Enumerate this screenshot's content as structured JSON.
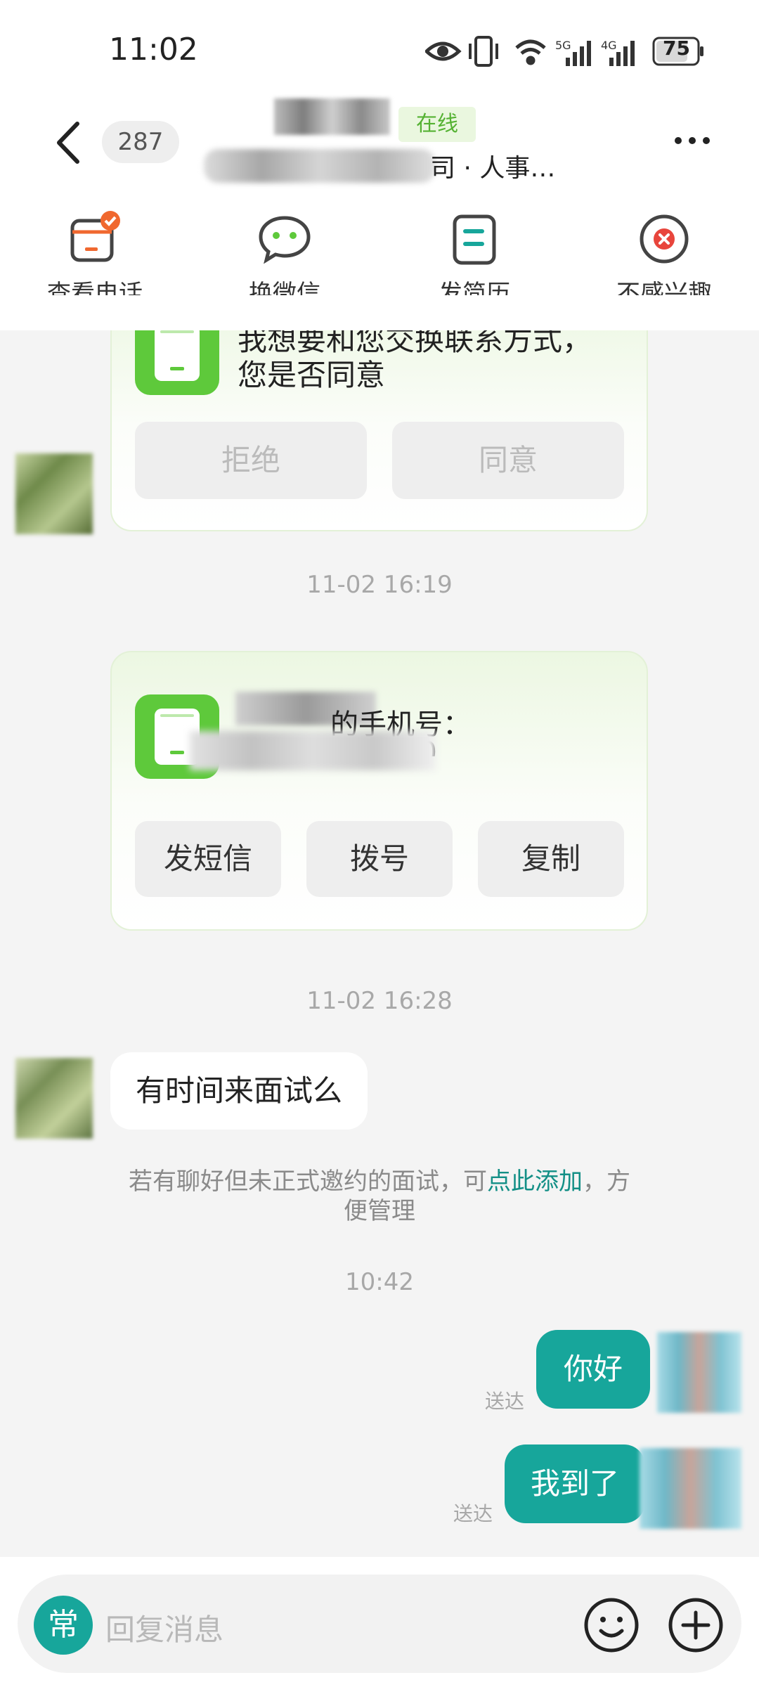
{
  "status": {
    "time": "11:02",
    "battery": "75",
    "net1": "5G",
    "net2": "4G"
  },
  "header": {
    "unread_count": "287",
    "online_badge": "在线",
    "company_suffix": "司 · 人事…"
  },
  "actions": [
    {
      "label": "查看电话",
      "icon": "phone-card-icon"
    },
    {
      "label": "换微信",
      "icon": "wechat-icon"
    },
    {
      "label": "发简历",
      "icon": "resume-icon"
    },
    {
      "label": "不感兴趣",
      "icon": "not-interested-icon"
    }
  ],
  "chat": {
    "exchange_card": {
      "text_line1": "我想要和您交换联系方式，",
      "text_line2": "您是否同意",
      "reject": "拒绝",
      "agree": "同意"
    },
    "ts1": "11-02 16:19",
    "phone_card": {
      "text_line1": "的手机号：",
      "text_line2": "3620",
      "sms": "发短信",
      "dial": "拨号",
      "copy": "复制"
    },
    "ts2": "11-02 16:28",
    "msg_in": "有时间来面试么",
    "tip_prefix": "若有聊好但未正式邀约的面试，可",
    "tip_link": "点此添加",
    "tip_suffix": "，方",
    "tip_line2": "便管理",
    "ts3": "10:42",
    "msg_out1": "你好",
    "msg_out2": "我到了",
    "delivered": "送达"
  },
  "input": {
    "quick_label": "常",
    "placeholder": "回复消息"
  },
  "colors": {
    "accent": "#17a69b",
    "green": "#5ec93b",
    "link": "#138f86"
  }
}
